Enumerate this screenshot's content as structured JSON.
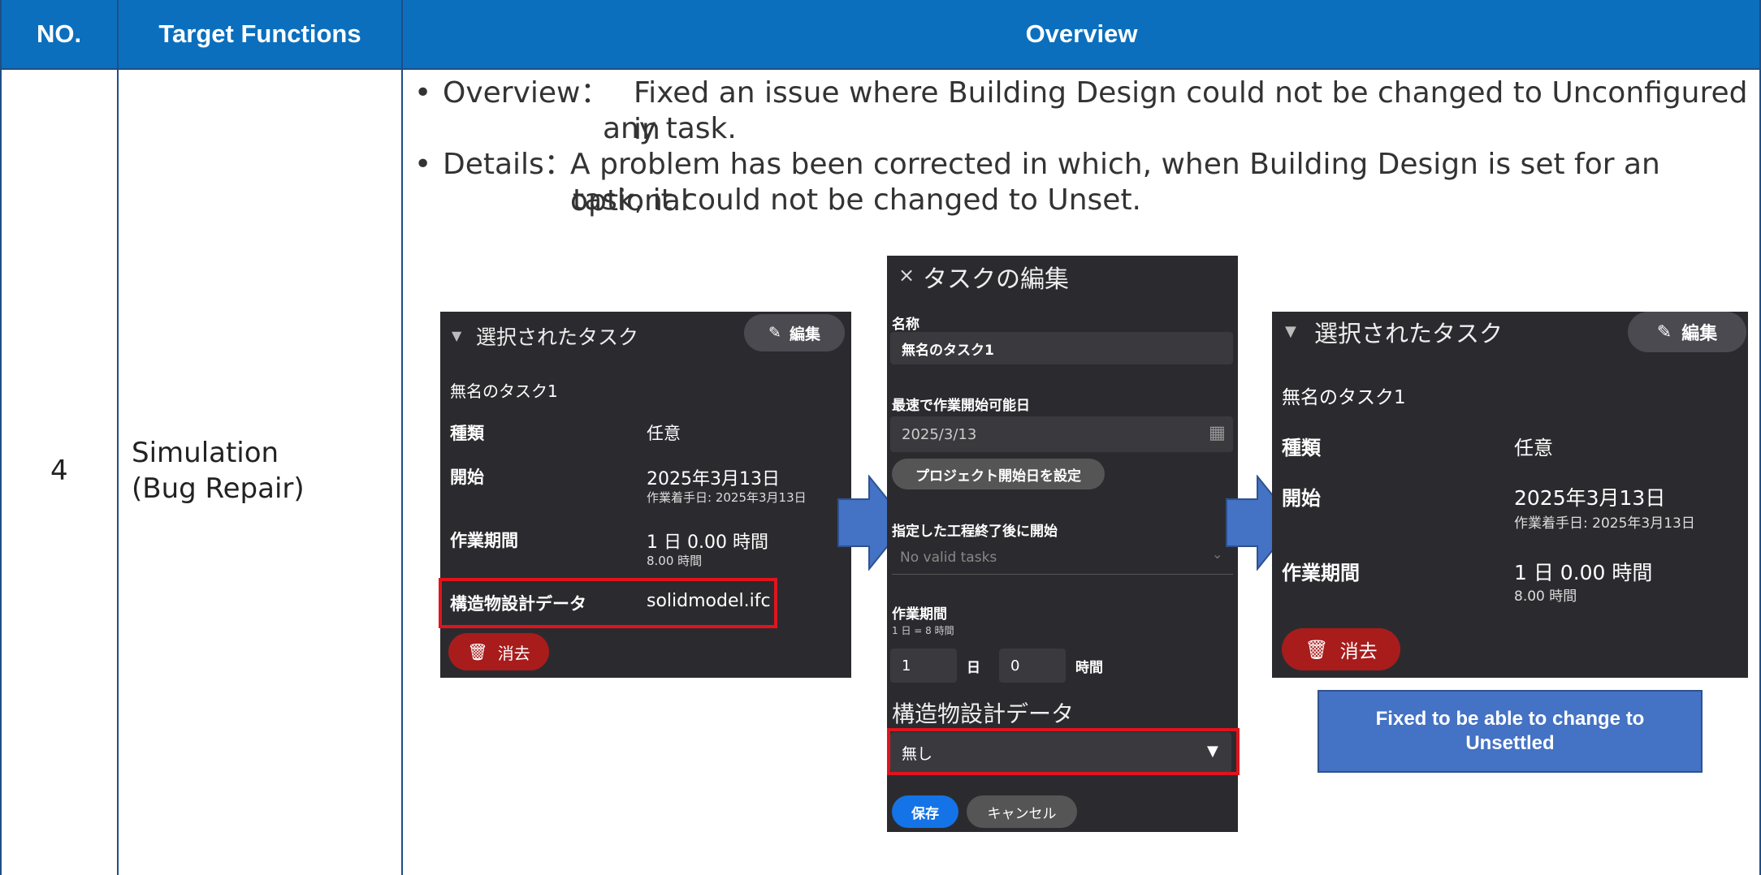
{
  "table": {
    "headers": [
      "NO.",
      "Target Functions",
      "Overview"
    ],
    "row": {
      "no": "4",
      "target_line1": "Simulation",
      "target_line2": "(Bug Repair)",
      "overview_label": "Overview：",
      "overview_text1": "Fixed an issue where Building Design could not be changed to Unconfigured in",
      "overview_text2": "any task.",
      "details_label": "Details：",
      "details_text1": "A problem has been corrected in which, when Building Design is set for an optional",
      "details_text2": "task, it could not be changed to Unset."
    }
  },
  "panel_before": {
    "title": "選択されたタスク",
    "edit_label": "編集",
    "task_name": "無名のタスク1",
    "type_label": "種類",
    "type_value": "任意",
    "start_label": "開始",
    "start_value": "2025年3月13日",
    "start_sub": "作業着手日: 2025年3月13日",
    "period_label": "作業期間",
    "period_value": "1 日 0.00 時間",
    "period_sub": "8.00 時間",
    "design_label": "構造物設計データ",
    "design_value": "solidmodel.ifc",
    "delete_label": "消去"
  },
  "panel_edit": {
    "title": "タスクの編集",
    "close_glyph": "×",
    "name_label": "名称",
    "name_value": "無名のタスク1",
    "earliest_label": "最速で作業開始可能日",
    "earliest_value": "2025/3/13",
    "project_start_button": "プロジェクト開始日を設定",
    "after_label": "指定した工程終了後に開始",
    "after_placeholder": "No valid tasks",
    "period_label": "作業期間",
    "period_hint": "1 日 = 8 時間",
    "days_value": "1",
    "days_unit": "日",
    "hours_value": "0",
    "hours_unit": "時間",
    "design_label": "構造物設計データ",
    "design_value": "無し",
    "save_label": "保存",
    "cancel_label": "キャンセル"
  },
  "panel_after": {
    "title": "選択されたタスク",
    "edit_label": "編集",
    "task_name": "無名のタスク1",
    "type_label": "種類",
    "type_value": "任意",
    "start_label": "開始",
    "start_value": "2025年3月13日",
    "start_sub": "作業着手日: 2025年3月13日",
    "period_label": "作業期間",
    "period_value": "1 日 0.00 時間",
    "period_sub": "8.00 時間",
    "delete_label": "消去"
  },
  "callout": {
    "line1": "Fixed to be able to change to",
    "line2": "Unsettled"
  },
  "colors": {
    "header_bg": "#0b6fbd",
    "panel_bg": "#2b2b2f",
    "highlight": "#e0141e",
    "delete_red": "#a81c1c",
    "arrow_blue": "#4472c4",
    "save_blue": "#1473e6"
  }
}
